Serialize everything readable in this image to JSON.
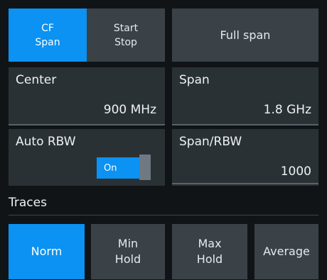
{
  "top_row": {
    "cf_span_line1": "CF",
    "cf_span_line2": "Span",
    "start_stop_line1": "Start",
    "start_stop_line2": "Stop",
    "full_span": "Full span"
  },
  "center": {
    "label": "Center",
    "value": "900 MHz"
  },
  "span": {
    "label": "Span",
    "value": "1.8 GHz"
  },
  "auto_rbw": {
    "label": "Auto RBW",
    "toggle_text": "On",
    "state": "on"
  },
  "span_rbw": {
    "label": "Span/RBW",
    "value": "1000"
  },
  "traces": {
    "label": "Traces",
    "buttons": {
      "norm": "Norm",
      "min_hold_line1": "Min",
      "min_hold_line2": "Hold",
      "max_hold_line1": "Max",
      "max_hold_line2": "Hold",
      "average": "Average"
    }
  },
  "colors": {
    "accent": "#0b92f2",
    "button_bg": "#3a4248",
    "panel_bg": "#2a3135",
    "background": "#111416"
  }
}
